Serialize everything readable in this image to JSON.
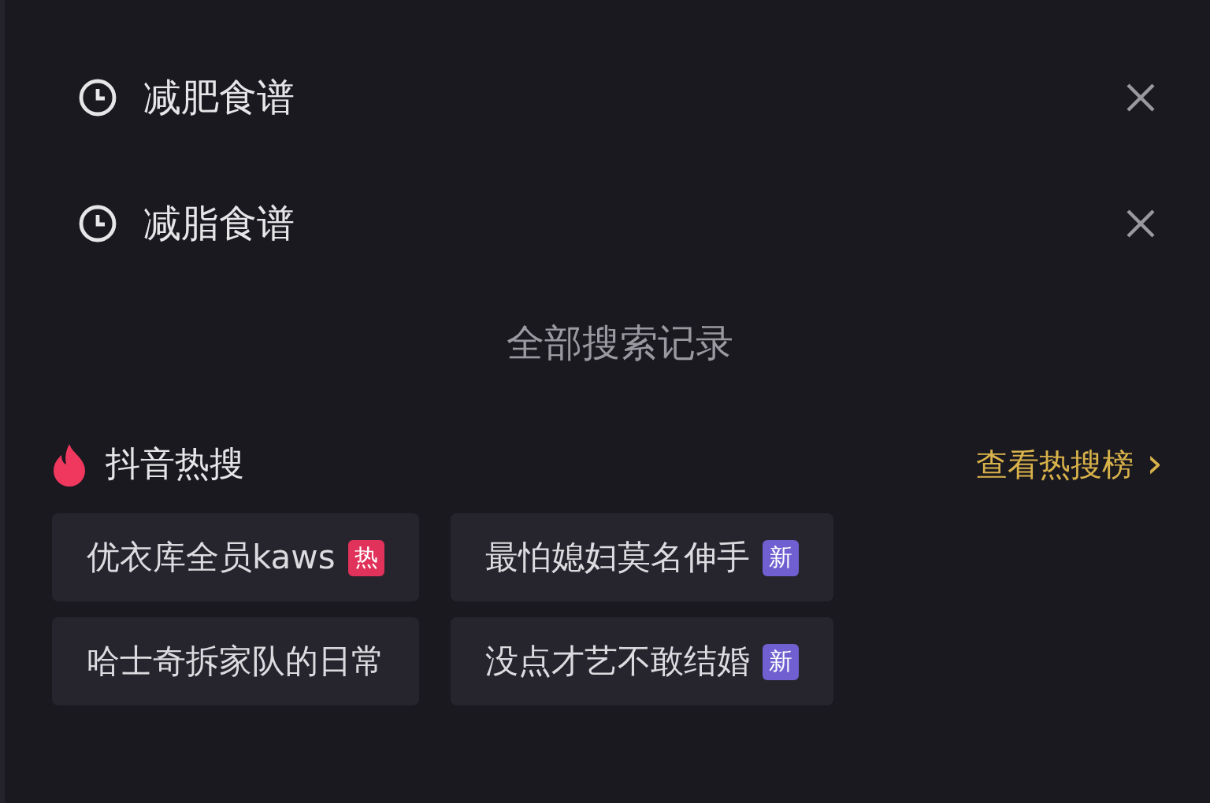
{
  "history": [
    {
      "text": "减肥食谱"
    },
    {
      "text": "减脂食谱"
    }
  ],
  "all_history_link": "全部搜索记录",
  "hot_search": {
    "title": "抖音热搜",
    "more_link": "查看热搜榜",
    "more_arrow": "›",
    "items": [
      {
        "text": "优衣库全员kaws",
        "badge": {
          "kind": "hot",
          "text": "热"
        }
      },
      {
        "text": "最怕媳妇莫名伸手",
        "badge": {
          "kind": "new",
          "text": "新"
        }
      },
      {
        "text": "哈士奇拆家队的日常"
      },
      {
        "text": "没点才艺不敢结婚",
        "badge": {
          "kind": "new",
          "text": "新"
        }
      }
    ]
  }
}
